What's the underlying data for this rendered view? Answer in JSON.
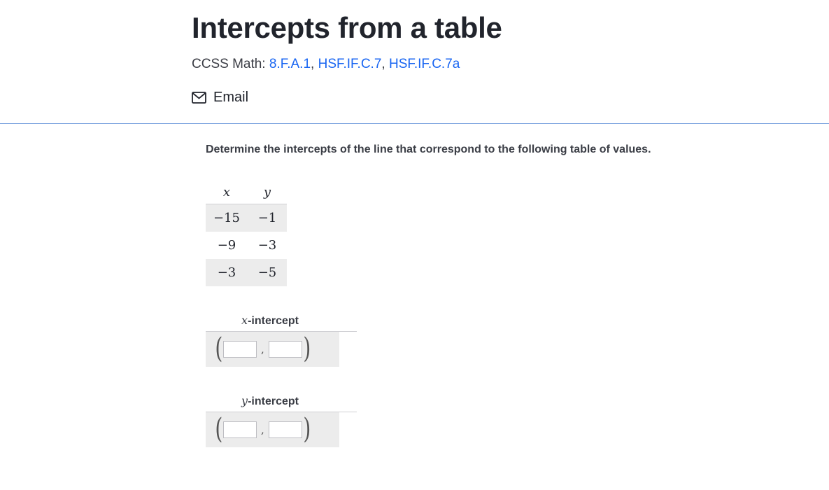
{
  "header": {
    "title": "Intercepts from a table",
    "ccss_prefix": "CCSS Math: ",
    "standards": [
      "8.F.A.1",
      "HSF.IF.C.7",
      "HSF.IF.C.7a"
    ],
    "standards_separator": ", ",
    "email_label": "Email"
  },
  "question": {
    "prompt": "Determine the intercepts of the line that correspond to the following table of values.",
    "table": {
      "headers": [
        "x",
        "y"
      ],
      "rows": [
        [
          "−15",
          "−1"
        ],
        [
          "−9",
          "−3"
        ],
        [
          "−3",
          "−5"
        ]
      ]
    },
    "answers": [
      {
        "var": "x",
        "label_suffix": "-intercept",
        "comma": ","
      },
      {
        "var": "y",
        "label_suffix": "-intercept",
        "comma": ","
      }
    ]
  },
  "colors": {
    "link": "#1865f2",
    "divider": "#7fa6e0",
    "shaded_row": "#ececec"
  }
}
